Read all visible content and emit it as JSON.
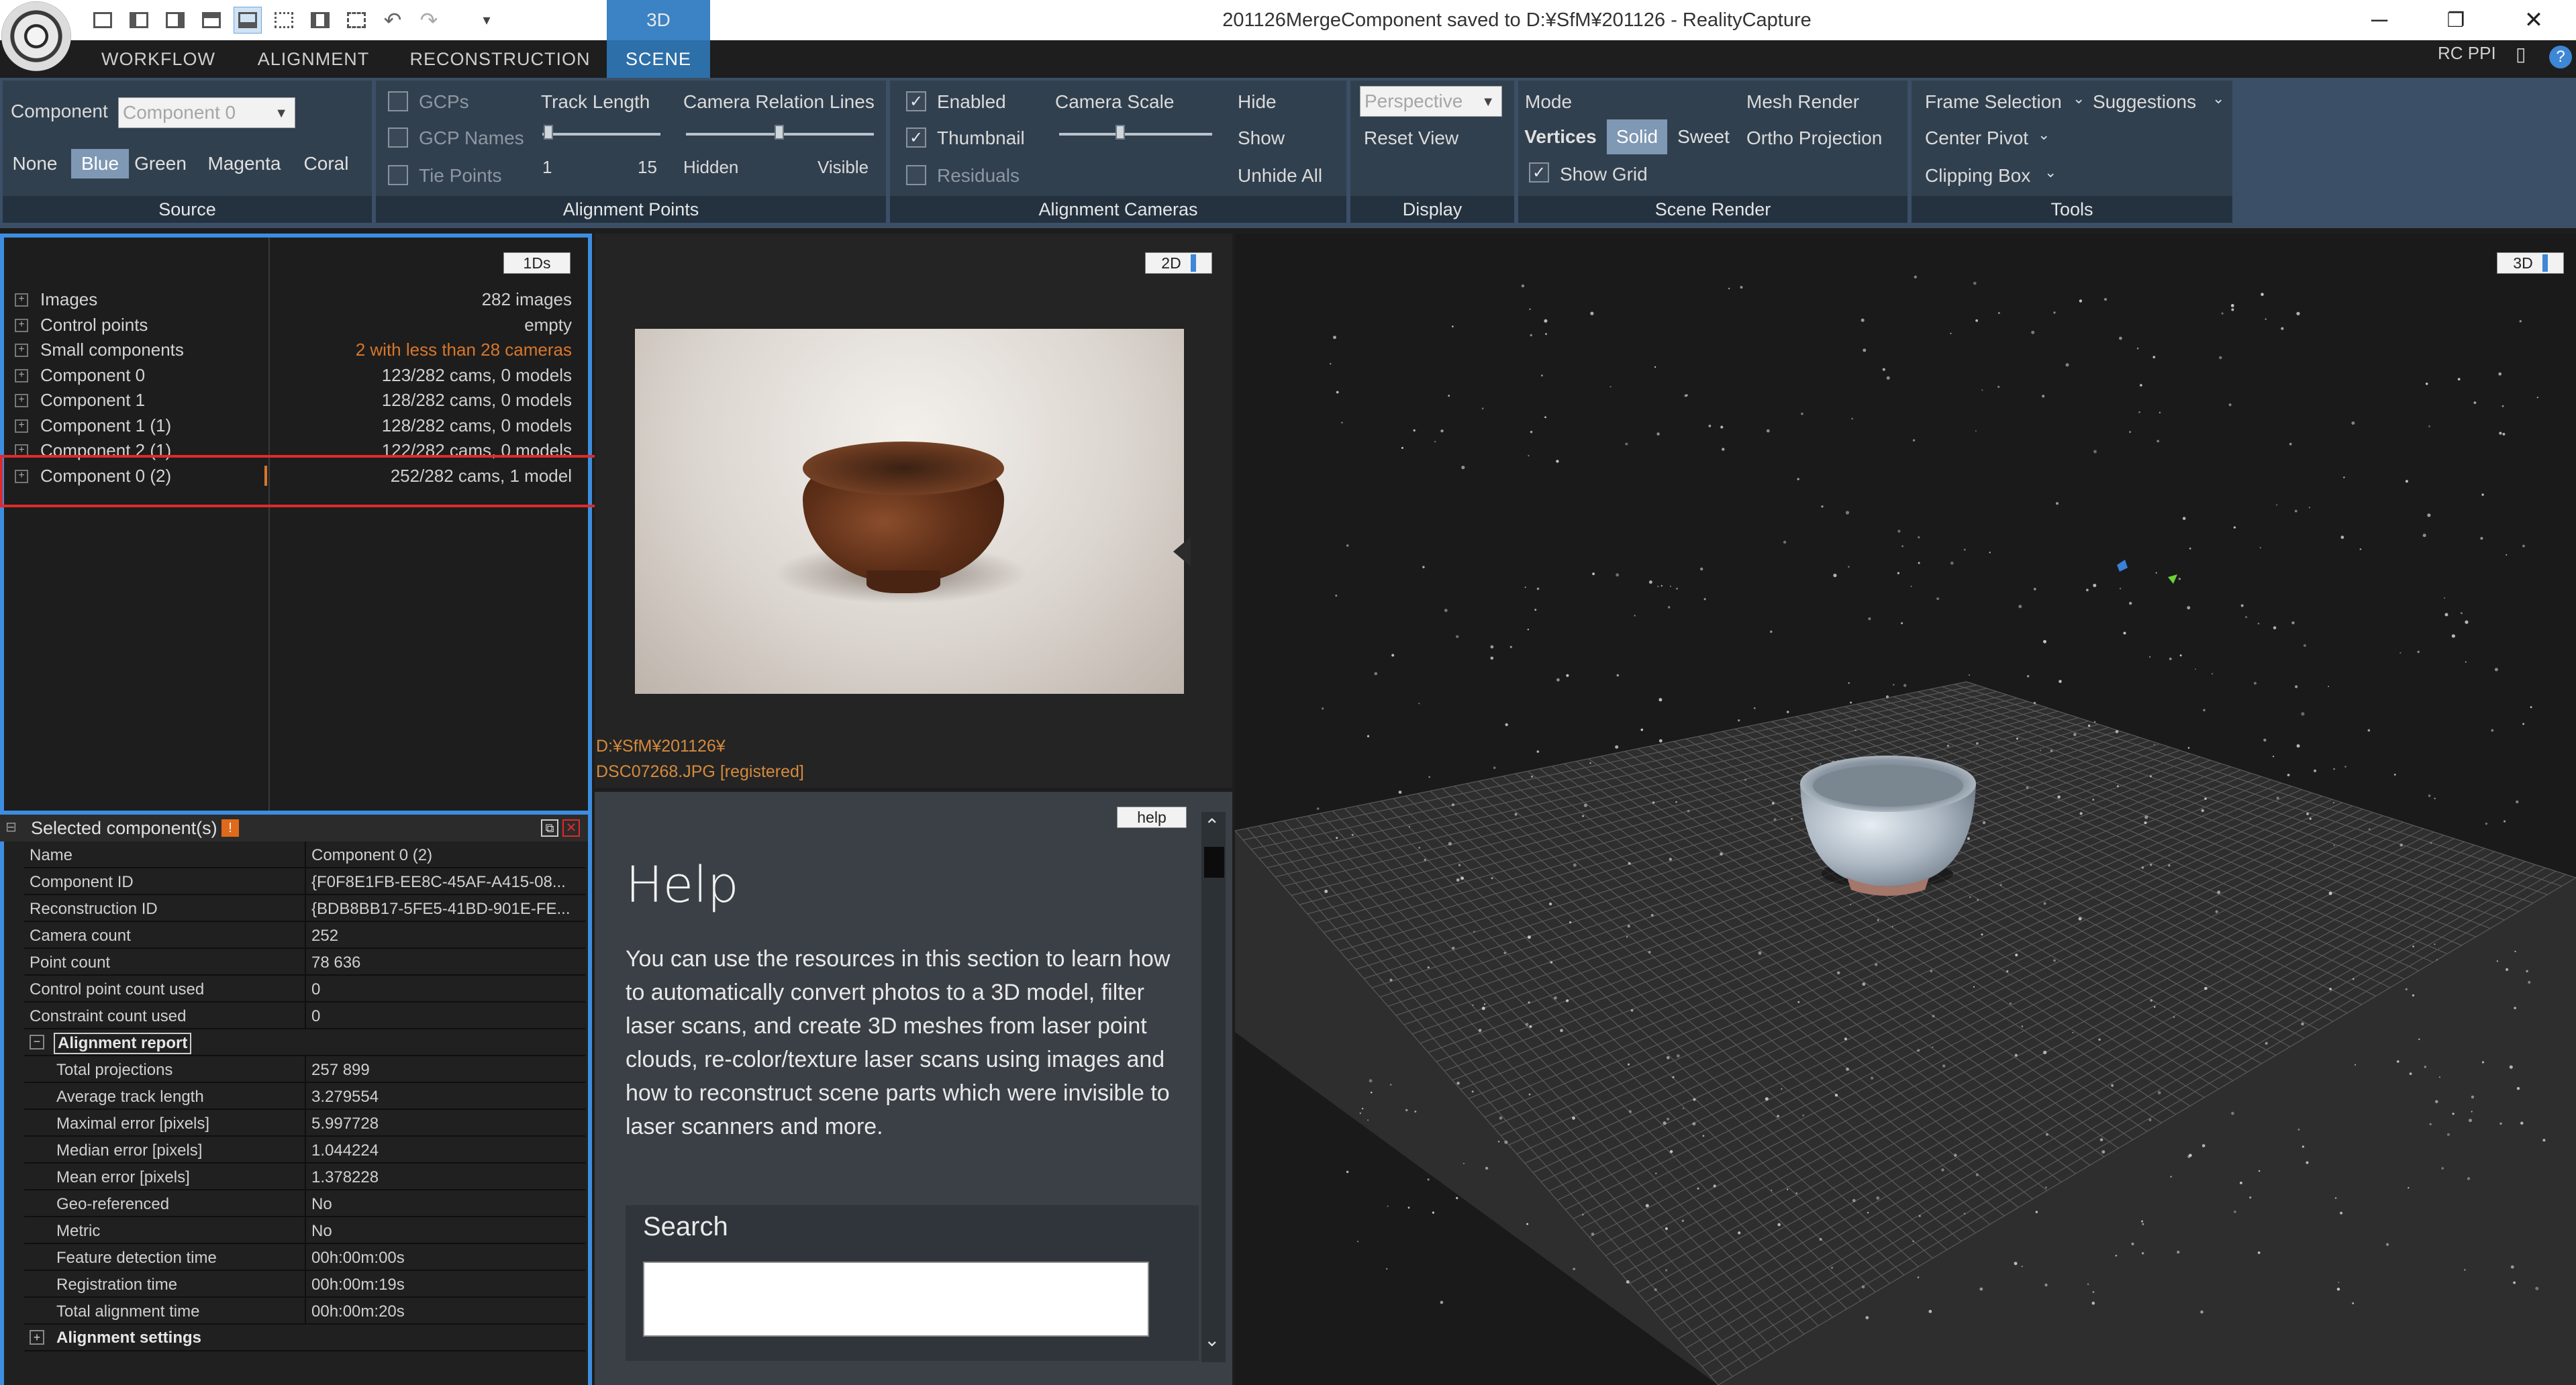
{
  "window": {
    "title": "201126MergeComponent saved to D:¥SfM¥201126 - RealityCapture",
    "layout_tab": "3D",
    "min": "─",
    "restore": "❐",
    "close": "✕"
  },
  "menu": {
    "tabs": [
      "WORKFLOW",
      "ALIGNMENT",
      "RECONSTRUCTION",
      "SCENE"
    ],
    "active": "SCENE",
    "rc_ppi": "RC PPI"
  },
  "ribbon": {
    "source": {
      "title": "Source",
      "component_label": "Component",
      "component_value": "Component 0",
      "colors": [
        "None",
        "Blue",
        "Green",
        "Magenta",
        "Coral"
      ],
      "active_color": "Blue"
    },
    "alignment_points": {
      "title": "Alignment Points",
      "gcps": "GCPs",
      "gcp_names": "GCP Names",
      "tie_points": "Tie Points",
      "track_length": "Track Length",
      "track_min": "1",
      "track_max": "15",
      "relation_lines": "Camera Relation Lines",
      "hidden": "Hidden",
      "visible": "Visible"
    },
    "alignment_cameras": {
      "title": "Alignment Cameras",
      "enabled": "Enabled",
      "thumbnail": "Thumbnail",
      "residuals": "Residuals",
      "camera_scale": "Camera Scale",
      "hide": "Hide",
      "show": "Show",
      "unhide_all": "Unhide All"
    },
    "display": {
      "title": "Display",
      "projection_value": "Perspective",
      "reset_view": "Reset View"
    },
    "scene_render": {
      "title": "Scene Render",
      "mode": "Mode",
      "mesh_render": "Mesh Render",
      "modes": [
        "Vertices",
        "Solid",
        "Sweet"
      ],
      "active_mode": "Solid",
      "ortho": "Ortho Projection",
      "show_grid": "Show Grid"
    },
    "tools": {
      "title": "Tools",
      "frame_selection": "Frame Selection",
      "suggestions": "Suggestions",
      "center_pivot": "Center Pivot",
      "clipping_box": "Clipping Box"
    }
  },
  "tree": {
    "tag": "1Ds",
    "rows": [
      {
        "name": "Images",
        "value": "282 images",
        "warn": false
      },
      {
        "name": "Control points",
        "value": "empty",
        "warn": false
      },
      {
        "name": "Small components",
        "value": "2 with less than 28 cameras",
        "warn": true
      },
      {
        "name": "Component 0",
        "value": "123/282 cams, 0 models",
        "warn": false
      },
      {
        "name": "Component 1",
        "value": "128/282 cams, 0 models",
        "warn": false
      },
      {
        "name": "Component 1 (1)",
        "value": "128/282 cams, 0 models",
        "warn": false
      },
      {
        "name": "Component 2 (1)",
        "value": "122/282 cams, 0 models",
        "warn": false
      },
      {
        "name": "Component 0 (2)",
        "value": "252/282 cams, 1 model",
        "warn": false
      }
    ]
  },
  "props": {
    "header": "Selected component(s)",
    "rows": [
      {
        "k": "Name",
        "v": "Component 0 (2)"
      },
      {
        "k": "Component ID",
        "v": "{F0F8E1FB-EE8C-45AF-A415-08..."
      },
      {
        "k": "Reconstruction ID",
        "v": "{BDB8BB17-5FE5-41BD-901E-FE..."
      },
      {
        "k": "Camera count",
        "v": "252"
      },
      {
        "k": "Point count",
        "v": "78 636"
      },
      {
        "k": "Control point count used",
        "v": "0"
      },
      {
        "k": "Constraint count used",
        "v": "0"
      }
    ],
    "alignment_report": "Alignment report",
    "report_rows": [
      {
        "k": "Total projections",
        "v": "257 899"
      },
      {
        "k": "Average track length",
        "v": "3.279554"
      },
      {
        "k": "Maximal error [pixels]",
        "v": "5.997728"
      },
      {
        "k": "Median error [pixels]",
        "v": "1.044224"
      },
      {
        "k": "Mean error [pixels]",
        "v": "1.378228"
      },
      {
        "k": "Geo-referenced",
        "v": "No"
      },
      {
        "k": "Metric",
        "v": "No"
      },
      {
        "k": "Feature detection time",
        "v": "00h:00m:00s"
      },
      {
        "k": "Registration time",
        "v": "00h:00m:19s"
      },
      {
        "k": "Total alignment time",
        "v": "00h:00m:20s"
      }
    ],
    "alignment_settings": "Alignment settings"
  },
  "image_view": {
    "tag": "2D",
    "path": "D:¥SfM¥201126¥",
    "file": "DSC07268.JPG [registered]"
  },
  "help": {
    "tag": "help",
    "title": "Help",
    "body": "You can use the resources in this section to learn how to automatically convert photos to a 3D model, filter laser scans, and create 3D meshes from laser point clouds, re-color/texture laser scans using images and how to reconstruct scene parts which were invisible to laser scanners and more.",
    "search_label": "Search",
    "search_value": ""
  },
  "viewport": {
    "tag": "3D"
  }
}
